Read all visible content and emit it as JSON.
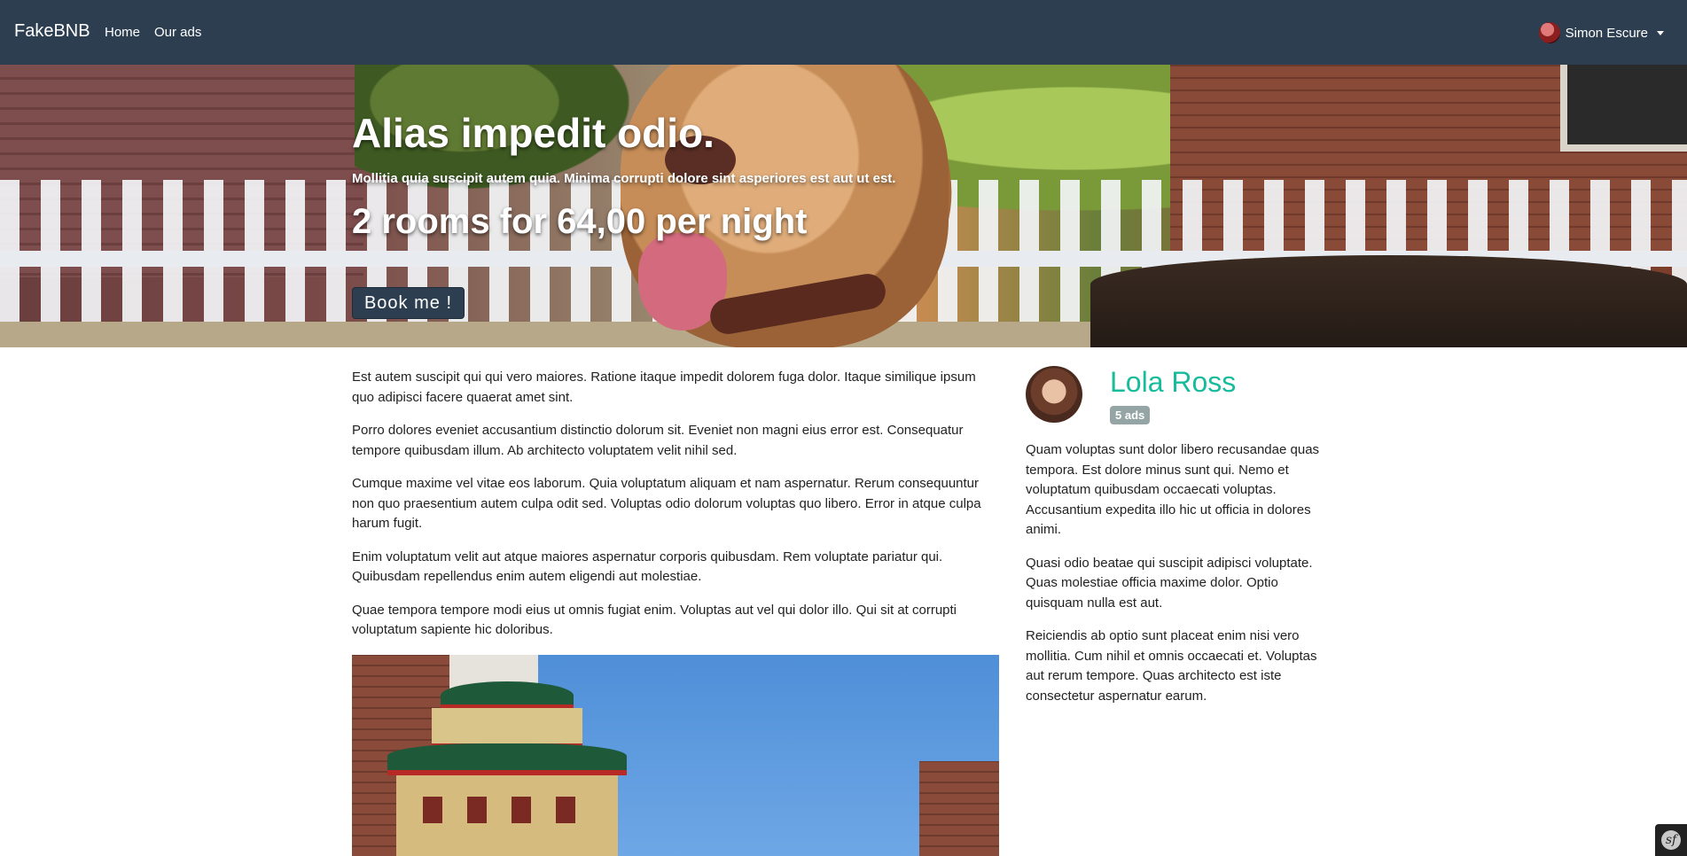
{
  "navbar": {
    "brand": "FakeBNB",
    "links": [
      "Home",
      "Our ads"
    ],
    "user": {
      "name": "Simon Escure",
      "avatar_icon": "user-avatar-icon"
    }
  },
  "hero": {
    "title": "Alias impedit odio.",
    "subtitle": "Mollitia quia suscipit autem quia. Minima corrupti dolore sint asperiores est aut ut est.",
    "price_line": "2 rooms for 64,00 per night",
    "book_button": "Book me !"
  },
  "content": {
    "paragraphs": [
      "Est autem suscipit qui qui vero maiores. Ratione itaque impedit dolorem fuga dolor. Itaque similique ipsum quo adipisci facere quaerat amet sint.",
      "Porro dolores eveniet accusantium distinctio dolorum sit. Eveniet non magni eius error est. Consequatur tempore quibusdam illum. Ab architecto voluptatem velit nihil sed.",
      "Cumque maxime vel vitae eos laborum. Quia voluptatum aliquam et nam aspernatur. Rerum consequuntur non quo praesentium autem culpa odit sed. Voluptas odio dolorum voluptas quo libero. Error in atque culpa harum fugit.",
      "Enim voluptatum velit aut atque maiores aspernatur corporis quibusdam. Rem voluptate pariatur qui. Quibusdam repellendus enim autem eligendi aut molestiae.",
      "Quae tempora tempore modi eius ut omnis fugiat enim. Voluptas aut vel qui dolor illo. Qui sit at corrupti voluptatum sapiente hic doloribus."
    ]
  },
  "owner": {
    "name": "Lola Ross",
    "ads_badge": "5 ads",
    "bio": [
      "Quam voluptas sunt dolor libero recusandae quas tempora. Est dolore minus sunt qui. Nemo et voluptatum quibusdam occaecati voluptas. Accusantium expedita illo hic ut officia in dolores animi.",
      "Quasi odio beatae qui suscipit adipisci voluptate. Quas molestiae officia maxime dolor. Optio quisquam nulla est aut.",
      "Reiciendis ab optio sunt placeat enim nisi vero mollitia. Cum nihil et omnis occaecati et. Voluptas aut rerum tempore. Quas architecto est iste consectetur aspernatur earum."
    ]
  },
  "colors": {
    "navbar_bg": "#2c3e50",
    "accent": "#18bc9c",
    "badge_bg": "#95a5a6"
  }
}
